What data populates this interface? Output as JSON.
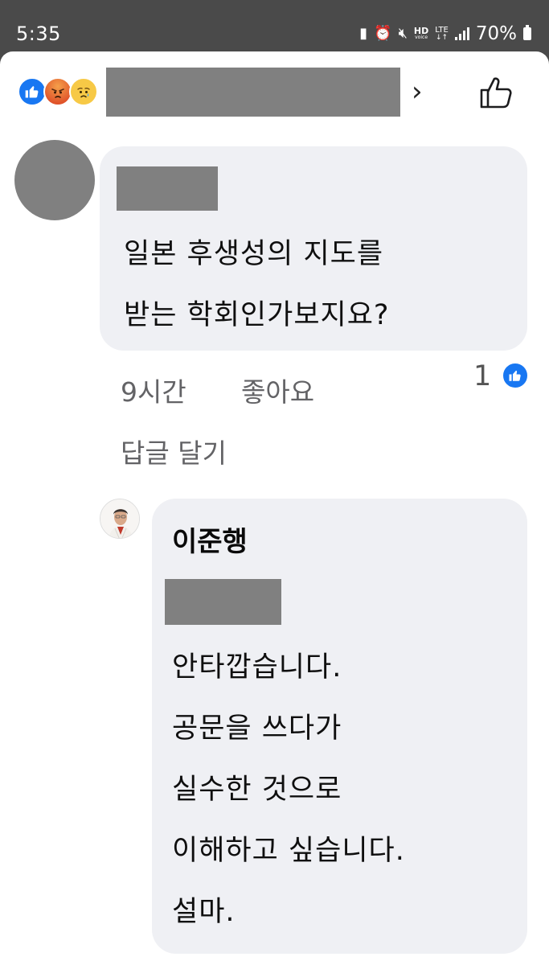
{
  "status_bar": {
    "time": "5:35",
    "battery": "70%",
    "hd_label": "HD",
    "hd_sub": "voice",
    "lte_label": "LTE",
    "lte_arrows": "↓↑"
  },
  "header": {
    "reactions": [
      "like",
      "angry",
      "sad"
    ]
  },
  "comment": {
    "lines": [
      "일본 후생성의 지도를",
      "받는 학회인가보지요?"
    ],
    "time": "9시간",
    "like_label": "좋아요",
    "reply_label": "답글 달기",
    "like_count": "1"
  },
  "reply": {
    "author": "이준행",
    "lines": [
      "안타깝습니다.",
      "공문을 쓰다가",
      "실수한 것으로",
      "이해하고 싶습니다.",
      "설마."
    ]
  },
  "colors": {
    "like_blue": "#1877f2",
    "bubble": "#eff0f4",
    "redaction": "#808080"
  },
  "icons": [
    "chevron-right-icon",
    "thumbs-up-icon",
    "alarm-icon",
    "mute-icon",
    "signal-icon",
    "battery-icon"
  ]
}
